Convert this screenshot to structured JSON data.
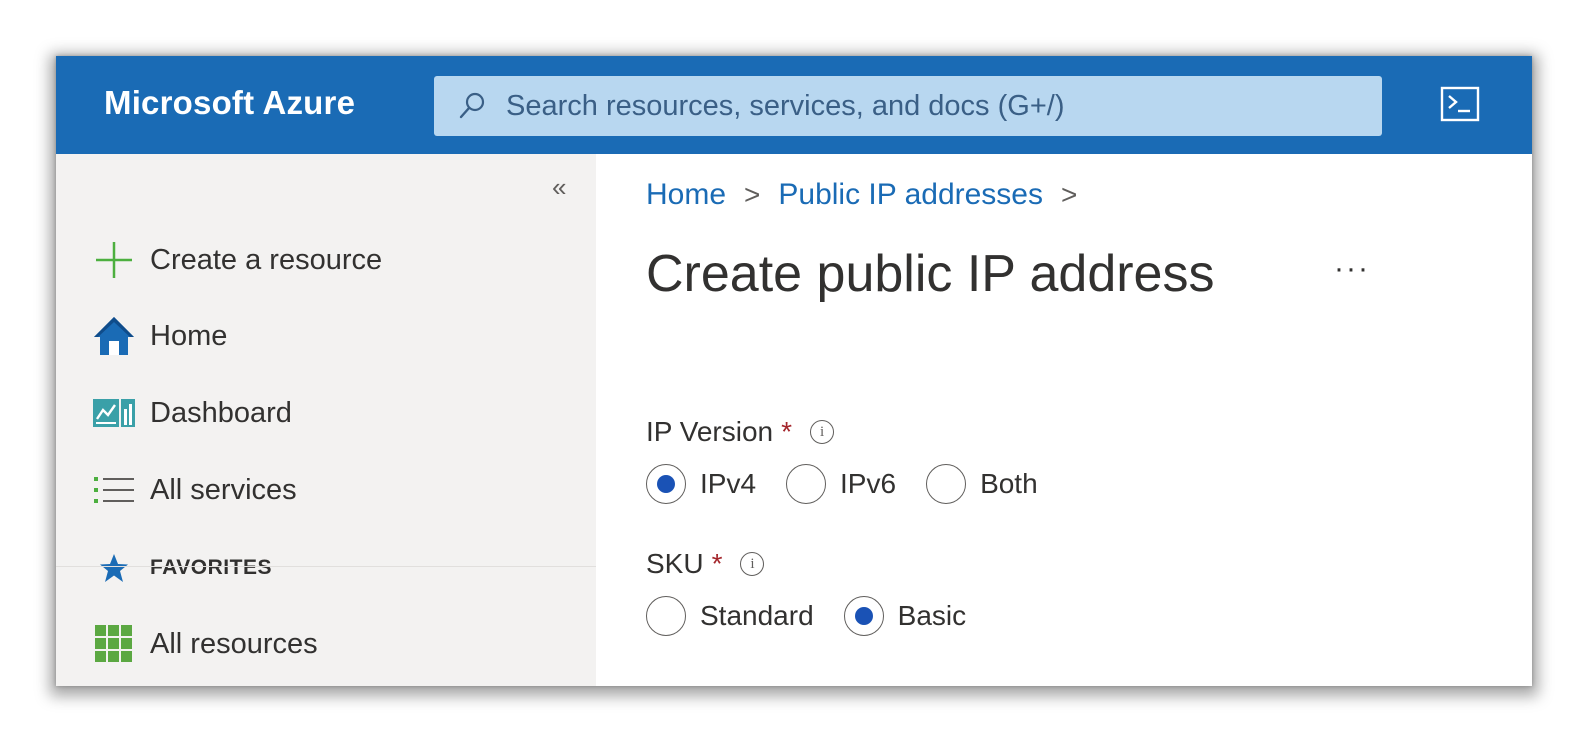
{
  "topbar": {
    "brand": "Microsoft Azure",
    "search_placeholder": "Search resources, services, and docs (G+/)",
    "bg_color": "#1a6bb5",
    "search_bg_color": "#b8d7f0",
    "shell_icon": "cloud-shell-icon"
  },
  "sidebar": {
    "collapse_glyph": "«",
    "items": [
      {
        "label": "Create a resource",
        "icon": "plus-icon"
      },
      {
        "label": "Home",
        "icon": "home-icon"
      },
      {
        "label": "Dashboard",
        "icon": "dashboard-icon"
      },
      {
        "label": "All services",
        "icon": "list-icon"
      }
    ],
    "favorites": {
      "label": "FAVORITES",
      "icon": "star-icon",
      "items": [
        {
          "label": "All resources",
          "icon": "grid-icon"
        }
      ]
    }
  },
  "main": {
    "breadcrumb": [
      {
        "label": "Home"
      },
      {
        "label": "Public IP addresses"
      }
    ],
    "breadcrumb_sep": ">",
    "title": "Create public IP address",
    "more": "···",
    "fields": {
      "ip_version": {
        "label": "IP Version",
        "required_mark": "*",
        "options": [
          {
            "label": "IPv4",
            "checked": true
          },
          {
            "label": "IPv6",
            "checked": false
          },
          {
            "label": "Both",
            "checked": false
          }
        ]
      },
      "sku": {
        "label": "SKU",
        "required_mark": "*",
        "options": [
          {
            "label": "Standard",
            "checked": false
          },
          {
            "label": "Basic",
            "checked": true
          }
        ]
      }
    }
  },
  "colors": {
    "link": "#1a6bb5",
    "required": "#a4262c",
    "radio_checked": "#1a52b5",
    "sidebar_bg": "#f3f2f1"
  }
}
